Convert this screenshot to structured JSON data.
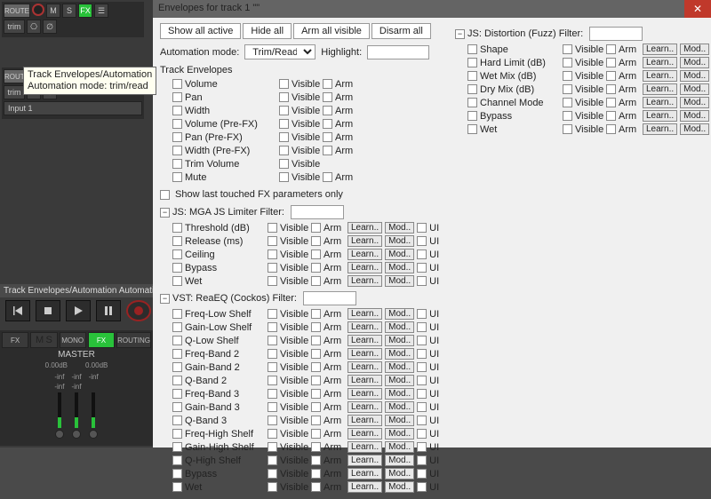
{
  "dialog_title": "Envelopes for track 1 \"\"",
  "buttons": {
    "show_all": "Show all active",
    "hide_all": "Hide all",
    "arm_all": "Arm all visible",
    "disarm_all": "Disarm all"
  },
  "mode_label": "Automation mode:",
  "mode_value": "Trim/Read",
  "highlight_label": "Highlight:",
  "track_env_header": "Track Envelopes",
  "track_params": [
    "Volume",
    "Pan",
    "Width",
    "Volume (Pre-FX)",
    "Pan (Pre-FX)",
    "Width (Pre-FX)",
    "Trim Volume",
    "Mute"
  ],
  "show_last": "Show last touched FX parameters only",
  "fx": [
    {
      "name": "JS: MGA JS Limiter",
      "params": [
        "Threshold (dB)",
        "Release (ms)",
        "Ceiling",
        "Bypass",
        "Wet"
      ]
    },
    {
      "name": "VST: ReaEQ (Cockos)",
      "params": [
        "Freq-Low Shelf",
        "Gain-Low Shelf",
        "Q-Low Shelf",
        "Freq-Band 2",
        "Gain-Band 2",
        "Q-Band 2",
        "Freq-Band 3",
        "Gain-Band 3",
        "Q-Band 3",
        "Freq-High Shelf",
        "Gain-High Shelf",
        "Q-High Shelf",
        "Bypass",
        "Wet"
      ]
    }
  ],
  "fx_right": [
    {
      "name": "JS: Distortion (Fuzz)",
      "params": [
        "Shape",
        "Hard Limit (dB)",
        "Wet Mix (dB)",
        "Dry Mix (dB)",
        "Channel Mode",
        "Bypass",
        "Wet"
      ]
    }
  ],
  "col_lbls": {
    "visible": "Visible",
    "arm": "Arm",
    "learn": "Learn..",
    "mod": "Mod..",
    "ui": "UI",
    "filter": "Filter:"
  },
  "tooltip_line1": "Track Envelopes/Automation",
  "tooltip_line2": "Automation mode: trim/read",
  "caption": "Track Envelopes/Automation Automation mo",
  "track_buttons": {
    "rec": "●",
    "m": "M",
    "s": "S",
    "fx": "FX",
    "io": "☰",
    "route": "ROUTE",
    "trim": "trim",
    "input": "Input 1"
  },
  "master": {
    "label": "MASTER",
    "fx": "FX",
    "m": "M",
    "s": "S",
    "routing": "ROUTING",
    "mono": "MONO",
    "db0": "0.00dB",
    "inf": "-inf"
  }
}
